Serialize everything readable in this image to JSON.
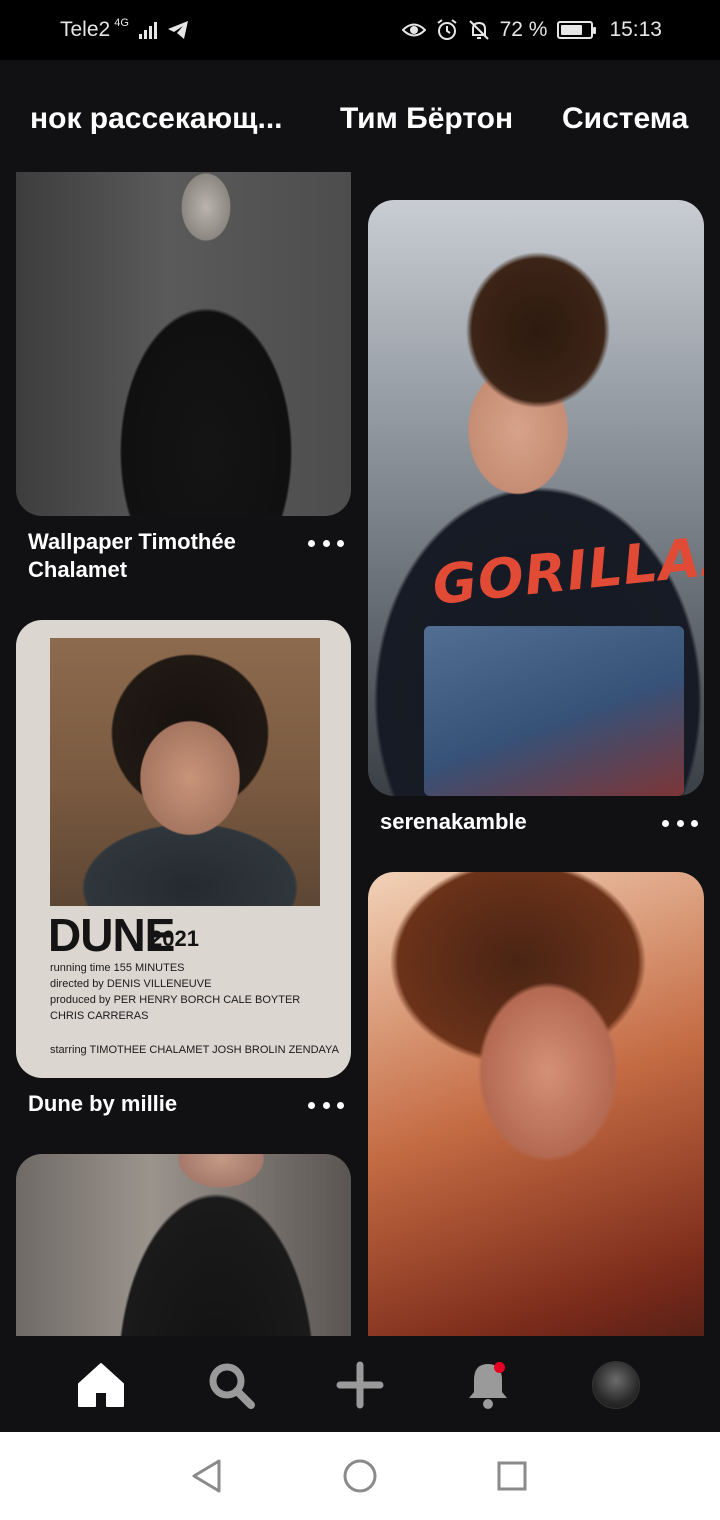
{
  "status_bar": {
    "carrier": "Tele2",
    "network": "4G",
    "battery": "72 %",
    "battery_level": 0.72,
    "time": "15:13",
    "icons": [
      "signal-icon",
      "telegram-icon",
      "eye-icon",
      "alarm-icon",
      "bell-off-icon",
      "battery-icon"
    ]
  },
  "topic_tabs": [
    "нок рассекающ...",
    "Тим Бёртон",
    "Система"
  ],
  "feed": {
    "pins": [
      {
        "title": "Wallpaper Timothée Chalamet",
        "more_icon": "more-dots-icon"
      },
      {
        "title": "serenakamble",
        "more_icon": "more-dots-icon"
      },
      {
        "title": "Dune by millie",
        "more_icon": "more-dots-icon"
      }
    ],
    "gorillaz_print": "GORILLAZ",
    "dune_poster": {
      "title": "DUNE",
      "year": "2021",
      "running_time": "running time  155 MINUTES",
      "directed_by": "directed by  DENIS VILLENEUVE",
      "produced_by": "produced by  PER HENRY BORCH  CALE BOYTER",
      "produced_by_2": "CHRIS CARRERAS",
      "starring": "starring  TIMOTHEE CHALAMET  JOSH BROLIN  ZENDAYA"
    }
  },
  "bottom_nav": {
    "items": [
      "home-icon",
      "search-icon",
      "add-icon",
      "notifications-icon",
      "profile-avatar"
    ],
    "active": "home-icon",
    "notification_dot_color": "#e60023"
  },
  "system_nav": [
    "back-icon",
    "home-circle-icon",
    "recents-icon"
  ]
}
